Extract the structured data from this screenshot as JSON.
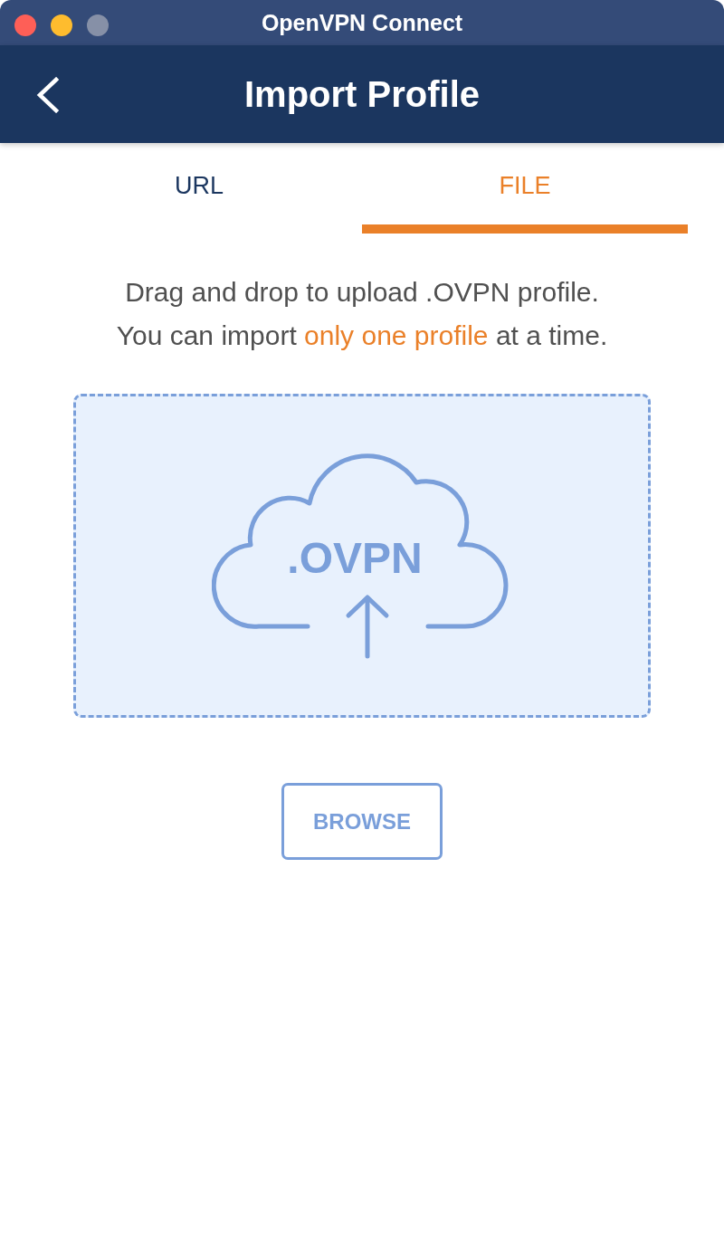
{
  "window": {
    "title": "OpenVPN Connect",
    "buttons": [
      {
        "kind": "close",
        "disabled": false
      },
      {
        "kind": "minimize",
        "disabled": false
      },
      {
        "kind": "zoom",
        "disabled": true
      }
    ]
  },
  "header": {
    "title": "Import Profile"
  },
  "tabs": [
    {
      "label": "URL",
      "selected": false
    },
    {
      "label": "FILE",
      "selected": true
    }
  ],
  "instructions": [
    [
      {
        "text": "Drag and drop to upload .OVPN profile.",
        "highlight": false
      }
    ],
    [
      {
        "text": "You can import ",
        "highlight": false
      },
      {
        "text": "only one profile",
        "highlight": true
      },
      {
        "text": " at a time.",
        "highlight": false
      }
    ]
  ],
  "drop_zone": {
    "file_type": ".OVPN"
  },
  "browse_button": {
    "label": "BROWSE"
  }
}
